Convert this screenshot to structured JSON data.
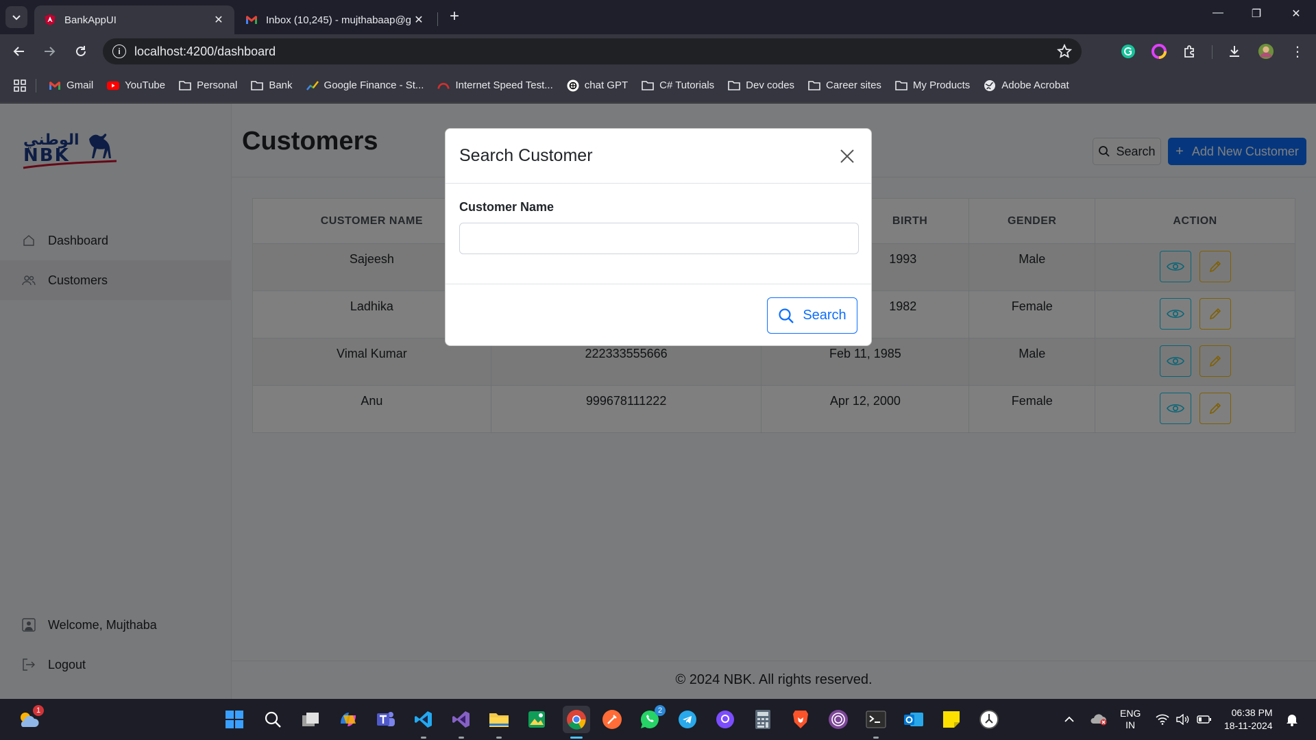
{
  "browser": {
    "tabs": [
      {
        "title": "BankAppUI",
        "active": true
      },
      {
        "title": "Inbox (10,245) - mujthabaap@g",
        "active": false
      }
    ],
    "url": "localhost:4200/dashboard",
    "bookmarks": [
      {
        "label": "Gmail",
        "icon": "gmail-icon"
      },
      {
        "label": "YouTube",
        "icon": "youtube-icon"
      },
      {
        "label": "Personal",
        "icon": "folder-icon"
      },
      {
        "label": "Bank",
        "icon": "folder-icon"
      },
      {
        "label": "Google Finance - St...",
        "icon": "google-finance-icon"
      },
      {
        "label": "Internet Speed Test...",
        "icon": "speedtest-icon"
      },
      {
        "label": "chat GPT",
        "icon": "chatgpt-icon"
      },
      {
        "label": "C# Tutorials",
        "icon": "folder-icon"
      },
      {
        "label": "Dev codes",
        "icon": "folder-icon"
      },
      {
        "label": "Career sites",
        "icon": "folder-icon"
      },
      {
        "label": "My Products",
        "icon": "folder-icon"
      },
      {
        "label": "Adobe Acrobat",
        "icon": "globe-icon"
      }
    ]
  },
  "sidebar": {
    "items": [
      {
        "label": "Dashboard",
        "icon": "home-icon",
        "active": false
      },
      {
        "label": "Customers",
        "icon": "users-icon",
        "active": true
      }
    ],
    "welcome": "Welcome, Mujthaba",
    "logout": "Logout"
  },
  "page": {
    "title": "Customers",
    "search_label": "Search",
    "add_label": "Add New Customer"
  },
  "table": {
    "headers": [
      "CUSTOMER NAME",
      "",
      "BIRTH",
      "GENDER",
      "ACTION"
    ],
    "rows": [
      {
        "name": "Sajeesh",
        "number": "",
        "dob": "1993",
        "gender": "Male"
      },
      {
        "name": "Ladhika",
        "number": "",
        "dob": "1982",
        "gender": "Female"
      },
      {
        "name": "Vimal Kumar",
        "number": "222333555666",
        "dob": "Feb 11, 1985",
        "gender": "Male"
      },
      {
        "name": "Anu",
        "number": "999678111222",
        "dob": "Apr 12, 2000",
        "gender": "Female"
      }
    ]
  },
  "footer": {
    "text": "© 2024 NBK. All rights reserved."
  },
  "modal": {
    "title": "Search Customer",
    "field_label": "Customer Name",
    "field_value": "",
    "search_button": "Search"
  },
  "taskbar": {
    "tray_lang_1": "ENG",
    "tray_lang_2": "IN",
    "time": "06:38 PM",
    "date": "18-11-2024",
    "weather_badge": "1",
    "whatsapp_badge": "2"
  },
  "colors": {
    "primary": "#0d6efd",
    "info": "#0dcaf0",
    "warning": "#ffc107",
    "nbk_blue": "#1a3a8a",
    "nbk_red": "#c8102e"
  }
}
